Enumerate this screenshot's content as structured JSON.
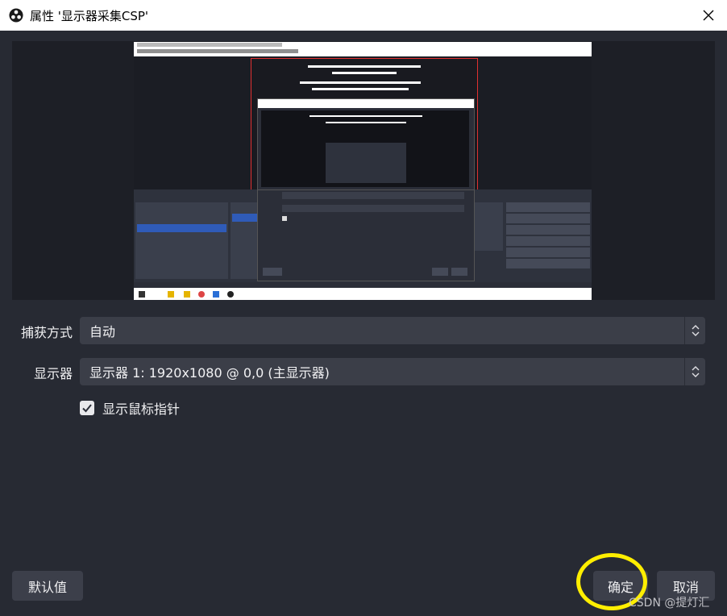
{
  "window": {
    "title": "属性 '显示器采集CSP'",
    "app_icon": "obs-logo-icon",
    "close_icon": "close-icon"
  },
  "form": {
    "capture_method": {
      "label": "捕获方式",
      "value": "自动"
    },
    "display": {
      "label": "显示器",
      "value": "显示器 1: 1920x1080 @ 0,0 (主显示器)"
    },
    "show_cursor": {
      "label": "显示鼠标指针",
      "checked": true
    }
  },
  "buttons": {
    "defaults": "默认值",
    "ok": "确定",
    "cancel": "取消"
  },
  "watermark": "CSDN @提灯汇",
  "colors": {
    "background": "#272a33",
    "field": "#3b3e48",
    "button": "#3c3f4a",
    "highlight_ring": "#ffee00",
    "selection": "#2f5bb8",
    "preview_border": "#e03030"
  }
}
